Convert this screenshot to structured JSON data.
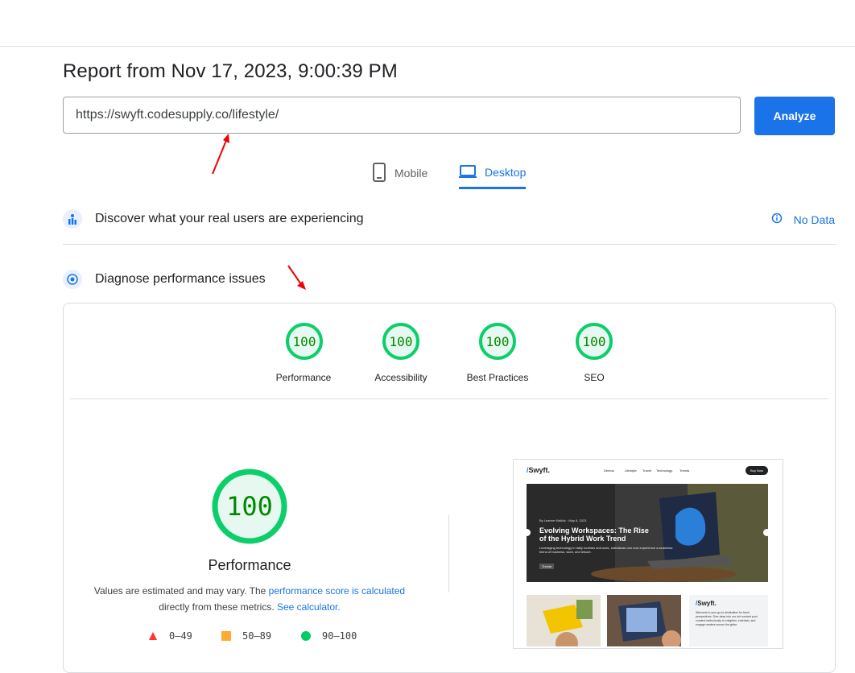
{
  "header": {
    "title": "Report from Nov 17, 2023, 9:00:39 PM"
  },
  "url_input": {
    "value": "https://swyft.codesupply.co/lifestyle/"
  },
  "analyze_label": "Analyze",
  "tabs": [
    {
      "label": "Mobile",
      "selected": false
    },
    {
      "label": "Desktop",
      "selected": true
    }
  ],
  "real_users": {
    "label": "Discover what your real users are experiencing",
    "status": "No Data"
  },
  "diagnose": {
    "label": "Diagnose performance issues"
  },
  "scores": [
    {
      "value": "100",
      "label": "Performance"
    },
    {
      "value": "100",
      "label": "Accessibility"
    },
    {
      "value": "100",
      "label": "Best Practices"
    },
    {
      "value": "100",
      "label": "SEO"
    }
  ],
  "main_score": {
    "value": "100",
    "title": "Performance",
    "desc_before": "Values are estimated and may vary. The ",
    "desc_link1": "performance score is calculated",
    "desc_middle": " directly from these metrics. ",
    "desc_link2": "See calculator."
  },
  "legend": [
    {
      "range": "0–49",
      "color": "#ff3333"
    },
    {
      "range": "50–89",
      "color": "#ffaa33"
    },
    {
      "range": "90–100",
      "color": "#00cc66"
    }
  ],
  "screenshot_preview": {
    "logo": "Swyft.",
    "nav": [
      "Demos",
      "Lifestyle",
      "Travel",
      "Technology",
      "Trends"
    ],
    "cta": "Buy Now",
    "byline": "By Leanne Wallick · May 8, 2023",
    "headline": "Evolving Workspaces: The Rise of the Hybrid Work Trend",
    "excerpt": "Leveraging technology in daily routines and work, individuals can now experience a seamless blend of business, work, and leisure.",
    "tag": "Trends",
    "side_logo": "Swyft.",
    "side_text": "Welcome to your go-to destination for fresh perspectives. Dive deep into our rich content pool curated meticulously to enlighten, entertain, and engage readers across the globe."
  },
  "colors": {
    "accent": "#1a73e8",
    "pass": "#0cce6b",
    "pass_text": "#008800"
  }
}
